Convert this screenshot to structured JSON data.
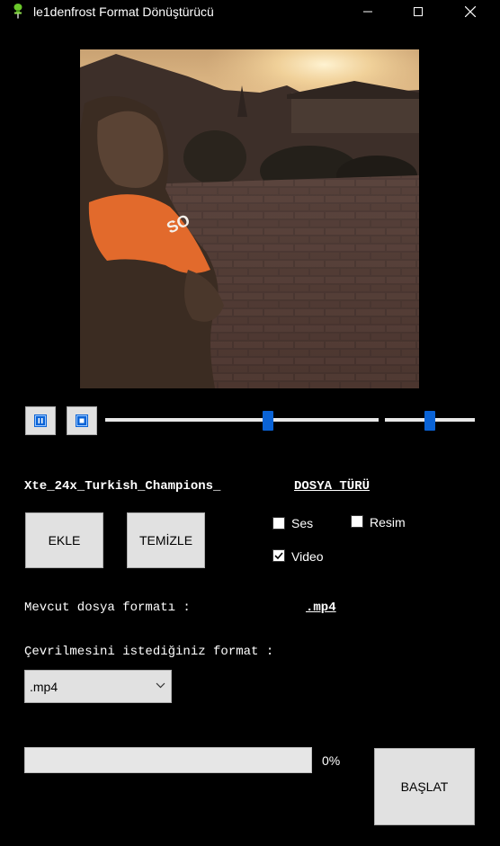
{
  "window": {
    "title": "le1denfrost Format Dönüştürücü",
    "icon": "pushpin-icon",
    "controls": [
      "minimize-icon",
      "maximize-icon",
      "close-icon"
    ]
  },
  "player": {
    "pause_icon": "pause-icon",
    "stop_icon": "stop-icon",
    "seek_fraction": 0.6,
    "volume_fraction": 0.5,
    "accent_color": "#0a63d6"
  },
  "file": {
    "name": "Xte_24x_Turkish_Champions_",
    "type_title": "DOSYA TÜRÜ"
  },
  "buttons": {
    "add": "EKLE",
    "clear": "TEMİZLE",
    "start": "BAŞLAT"
  },
  "file_types": [
    {
      "label": "Ses",
      "checked": false
    },
    {
      "label": "Resim",
      "checked": false
    },
    {
      "label": "Video",
      "checked": true
    }
  ],
  "formats": {
    "current_label": "Mevcut dosya formatı :",
    "current_value": ".mp4",
    "target_label": "Çevrilmesini istediğiniz format :",
    "selected": ".mp4"
  },
  "progress": {
    "value_percent": 0,
    "text": "0%",
    "fill_color": "#06b025"
  }
}
